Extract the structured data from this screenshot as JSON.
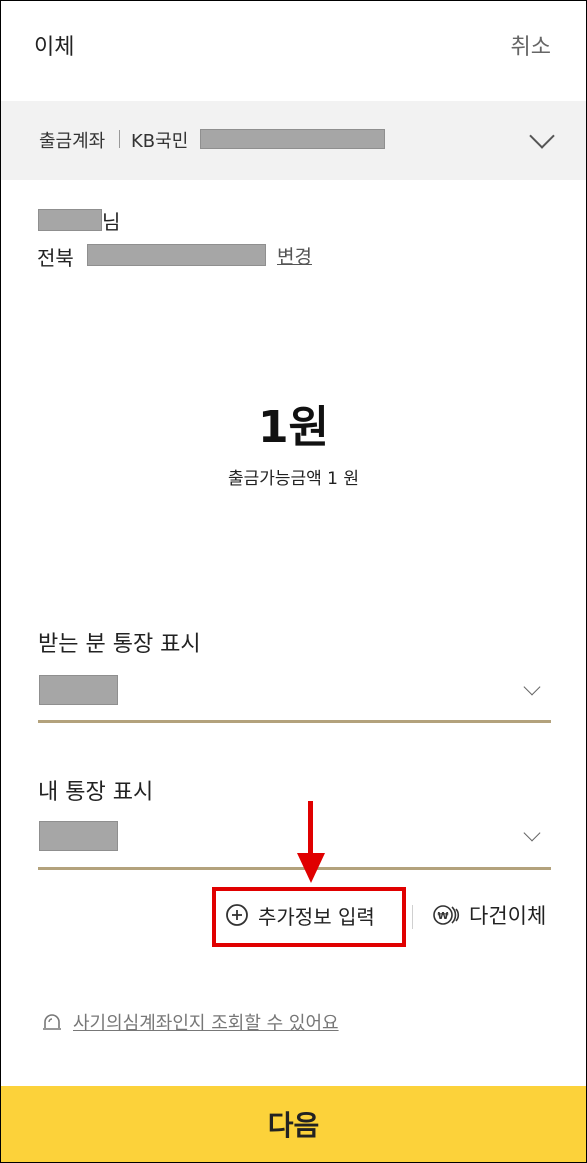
{
  "header": {
    "title": "이체",
    "cancel_label": "취소"
  },
  "withdraw_account": {
    "label": "출금계좌",
    "bank": "KB국민"
  },
  "recipient": {
    "name_suffix": "님",
    "bank": "전북",
    "change_label": "변경"
  },
  "amount": {
    "value": "1원",
    "available_text": "출금가능금액 1 원"
  },
  "fields": {
    "recipient_memo_label": "받는 분 통장 표시",
    "my_memo_label": "내 통장 표시"
  },
  "actions": {
    "add_info_label": "추가정보 입력",
    "multi_transfer_label": "다건이체"
  },
  "fraud_check_label": "사기의심계좌인지 조회할 수 있어요",
  "next_label": "다음",
  "colors": {
    "accent_yellow": "#fcd23a",
    "annotation_red": "#e00000",
    "underline_gold": "#b3a27c"
  },
  "icons": [
    "chevron-down-icon",
    "plus-circle-icon",
    "multi-transfer-icon",
    "siren-icon",
    "arrow-down-icon"
  ]
}
